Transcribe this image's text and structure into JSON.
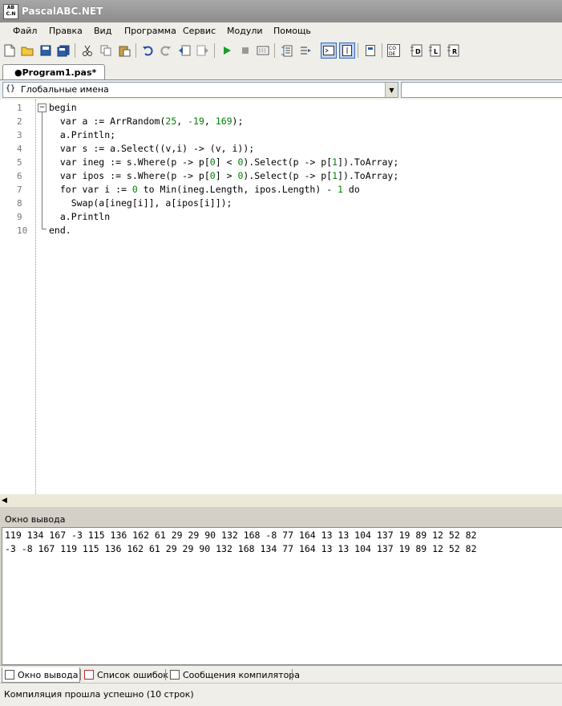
{
  "window": {
    "title": "PascalABC.NET",
    "icon_text": "ABC.NET"
  },
  "menu": [
    "Файл",
    "Правка",
    "Вид",
    "Программа",
    "Сервис",
    "Модули",
    "Помощь"
  ],
  "tab": {
    "label": "●Program1.pas*"
  },
  "scope": {
    "icon": "{}",
    "label": "Глобальные имена"
  },
  "code": {
    "line_numbers": [
      "1",
      "2",
      "3",
      "4",
      "5",
      "6",
      "7",
      "8",
      "9",
      "10"
    ],
    "l1": "begin",
    "l2a": "  var a := ArrRandom(",
    "l2n1": "25",
    "l2b": ", ",
    "l2n2": "-19",
    "l2c": ", ",
    "l2n3": "169",
    "l2d": ");",
    "l3": "  a.Println;",
    "l4": "  var s := a.Select((v,i) -> (v, i));",
    "l5a": "  var ineg := s.Where(p -> p[",
    "l5n1": "0",
    "l5b": "] < ",
    "l5n2": "0",
    "l5c": ").Select(p -> p[",
    "l5n3": "1",
    "l5d": "]).ToArray;",
    "l6a": "  var ipos := s.Where(p -> p[",
    "l6n1": "0",
    "l6b": "] > ",
    "l6n2": "0",
    "l6c": ").Select(p -> p[",
    "l6n3": "1",
    "l6d": "]).ToArray;",
    "l7a": "  for var i := ",
    "l7n1": "0",
    "l7b": " to Min(ineg.Length, ipos.Length) - ",
    "l7n2": "1",
    "l7c": " do",
    "l8": "    Swap(a[ineg[i]], a[ipos[i]]);",
    "l9": "  a.Println",
    "l10": "end."
  },
  "output": {
    "title": "Окно вывода",
    "lines": [
      "119 134 167 -3 115 136 162 61 29 29 90 132 168 -8 77 164 13 13 104 137 19 89 12 52 82",
      "-3 -8 167 119 115 136 162 61 29 29 90 132 168 134 77 164 13 13 104 137 19 89 12 52 82"
    ]
  },
  "bottom_tabs": [
    "Окно вывода",
    "Список ошибок",
    "Сообщения компилятора"
  ],
  "status": "Компиляция прошла успешно (10 строк)"
}
